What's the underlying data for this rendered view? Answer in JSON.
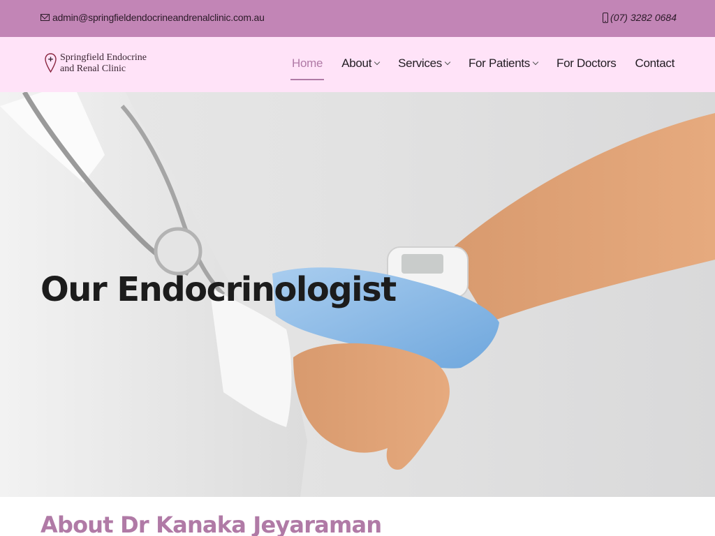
{
  "topbar": {
    "email": "admin@springfieldendocrineandrenalclinic.com.au",
    "phone": "(07) 3282 0684",
    "email_icon": "mail-icon",
    "phone_icon": "phone-icon"
  },
  "logo": {
    "line1": "Springfield Endocrine",
    "line2": "and Renal Clinic",
    "icon": "location-pin-cross-icon"
  },
  "nav": {
    "items": [
      {
        "label": "Home",
        "active": true
      },
      {
        "label": "About",
        "dropdown": true
      },
      {
        "label": "Services",
        "dropdown": true
      },
      {
        "label": "For Patients",
        "dropdown": true
      },
      {
        "label": "For Doctors"
      },
      {
        "label": "Contact"
      }
    ]
  },
  "hero": {
    "title": "Our Endocrinologist"
  },
  "about": {
    "heading": "About Dr Kanaka Jeyaraman"
  },
  "colors": {
    "topbar_bg": "#c285b6",
    "navbar_bg": "#ffe3f8",
    "accent": "#b07aa6",
    "text_dark": "#221c22"
  }
}
